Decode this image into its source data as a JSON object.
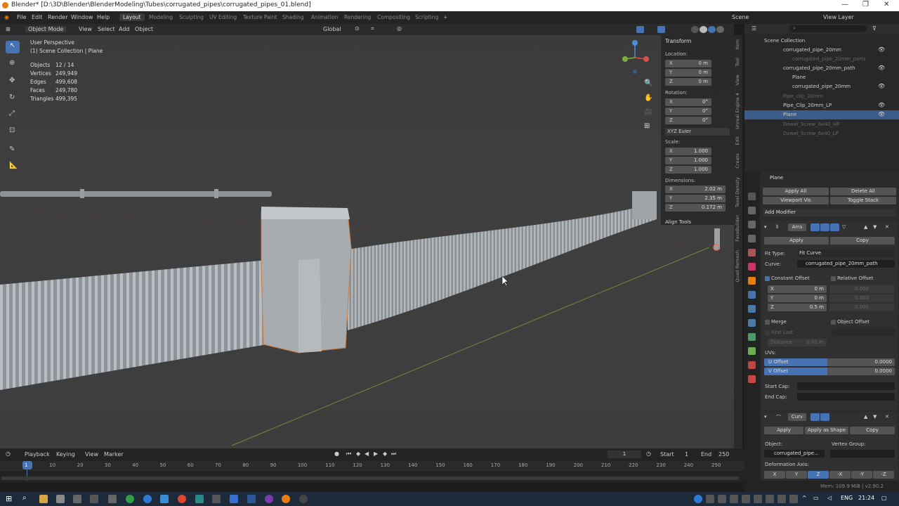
{
  "titlebar": {
    "title": "Blender* [D:\\3D\\Blender\\BlenderModeling\\Tubes\\corrugated_pipes\\corrugated_pipes_01.blend]",
    "minimize": "—",
    "maximize": "❐",
    "close": "✕"
  },
  "menu": [
    "File",
    "Edit",
    "Render",
    "Window",
    "Help"
  ],
  "workspaces": [
    "Layout",
    "Modeling",
    "Sculpting",
    "UV Editing",
    "Texture Paint",
    "Shading",
    "Animation",
    "Rendering",
    "Compositing",
    "Scripting"
  ],
  "scene": {
    "label": "Scene",
    "view_layer": "View Layer"
  },
  "vp_header": {
    "mode": "Object Mode",
    "menus": [
      "View",
      "Select",
      "Add",
      "Object"
    ],
    "transform": "Global"
  },
  "viewport": {
    "perspective": "User Perspective",
    "collection": "(1) Scene Collection | Plane",
    "stats": [
      {
        "k": "Objects",
        "v": "12 / 14"
      },
      {
        "k": "Vertices",
        "v": "249,949"
      },
      {
        "k": "Edges",
        "v": "499,608"
      },
      {
        "k": "Faces",
        "v": "249,780"
      },
      {
        "k": "Triangles",
        "v": "499,395"
      }
    ]
  },
  "npanel": {
    "transform_title": "Transform",
    "location_label": "Location:",
    "location": [
      {
        "k": "X",
        "v": "0 m"
      },
      {
        "k": "Y",
        "v": "0 m"
      },
      {
        "k": "Z",
        "v": "0 m"
      }
    ],
    "rotation_label": "Rotation:",
    "rotation": [
      {
        "k": "X",
        "v": "0°"
      },
      {
        "k": "Y",
        "v": "0°"
      },
      {
        "k": "Z",
        "v": "0°"
      }
    ],
    "rotation_mode": "XYZ Euler",
    "scale_label": "Scale:",
    "scale": [
      {
        "k": "X",
        "v": "1.000"
      },
      {
        "k": "Y",
        "v": "1.000"
      },
      {
        "k": "Z",
        "v": "1.000"
      }
    ],
    "dimensions_label": "Dimensions:",
    "dimensions": [
      {
        "k": "X",
        "v": "2.02 m"
      },
      {
        "k": "Y",
        "v": "2.35 m"
      },
      {
        "k": "Z",
        "v": "0.172 m"
      }
    ],
    "align_tools": "Align Tools"
  },
  "vtabs": [
    "Item",
    "Tool",
    "View",
    "Unreal Engine 4",
    "Edit",
    "Create",
    "Texel Density",
    "FaceBuilder",
    "Quad Remesh"
  ],
  "outliner": {
    "search_placeholder": "",
    "rows": [
      {
        "label": "Scene Collection",
        "indent": 0,
        "dim": false,
        "sel": false
      },
      {
        "label": "corrugated_pipe_20mm",
        "indent": 1,
        "dim": false,
        "sel": false
      },
      {
        "label": "corrugated_pipe_20mm_parts",
        "indent": 2,
        "dim": true,
        "sel": false
      },
      {
        "label": "corrugated_pipe_20mm_path",
        "indent": 2,
        "dim": false,
        "sel": false
      },
      {
        "label": "Plane",
        "indent": 3,
        "dim": false,
        "sel": false
      },
      {
        "label": "corrugated_pipe_20mm",
        "indent": 3,
        "dim": false,
        "sel": false
      },
      {
        "label": "Pipe_clip_20mm",
        "indent": 1,
        "dim": true,
        "sel": false
      },
      {
        "label": "Pipe_Clip_20mm_LP",
        "indent": 1,
        "dim": false,
        "sel": false
      },
      {
        "label": "Plane",
        "indent": 2,
        "dim": false,
        "sel": true
      },
      {
        "label": "Dowel_Screw_6x40_HP",
        "indent": 1,
        "dim": true,
        "sel": false
      },
      {
        "label": "Dowel_Screw_6x40_LP",
        "indent": 1,
        "dim": true,
        "sel": false
      }
    ]
  },
  "props": {
    "object": "Plane",
    "apply_all": "Apply All",
    "delete_all": "Delete All",
    "viewport_vis": "Viewport Vis",
    "toggle_stack": "Toggle Stack",
    "add_modifier": "Add Modifier",
    "array": {
      "name": "Arra",
      "apply": "Apply",
      "copy": "Copy",
      "fit_type_label": "Fit Type:",
      "fit_type": "Fit Curve",
      "curve_label": "Curve:",
      "curve": "corrugated_pipe_20mm_path",
      "constant_offset": "Constant Offset",
      "relative_offset": "Relative Offset",
      "const": [
        {
          "k": "X",
          "v": "0 m"
        },
        {
          "k": "Y",
          "v": "0 m"
        },
        {
          "k": "Z",
          "v": "0.5 m"
        }
      ],
      "rel": [
        {
          "k": "",
          "v": "0.000"
        },
        {
          "k": "",
          "v": "0.000"
        },
        {
          "k": "",
          "v": "0.000"
        }
      ],
      "merge": "Merge",
      "object_offset": "Object Offset",
      "first_last": "First Last",
      "distance": "Distance",
      "distance_val": "0.01 m",
      "uvs": "UVs:",
      "u_offset": "U Offset",
      "u_val": "0.0000",
      "v_offset": "V Offset",
      "v_val": "0.0000",
      "start_cap": "Start Cap:",
      "end_cap": "End Cap:"
    },
    "curve_mod": {
      "name": "Curv",
      "apply": "Apply",
      "apply_shape": "Apply as Shape",
      "copy": "Copy",
      "object_label": "Object:",
      "object": "corrugated_pipe...",
      "vertex_group": "Vertex Group:",
      "deform_axis": "Deformation Axis:",
      "axes": [
        "X",
        "Y",
        "Z",
        "-X",
        "-Y",
        "-Z"
      ]
    }
  },
  "timeline": {
    "menus": [
      "Playback",
      "Keying",
      "View",
      "Marker"
    ],
    "current": "1",
    "start_label": "Start",
    "start": "1",
    "end_label": "End",
    "end": "250",
    "ticks": [
      "1",
      "10",
      "20",
      "30",
      "40",
      "50",
      "60",
      "70",
      "80",
      "90",
      "100",
      "110",
      "120",
      "130",
      "140",
      "150",
      "160",
      "170",
      "180",
      "190",
      "200",
      "210",
      "220",
      "230",
      "240",
      "250"
    ]
  },
  "status": {
    "mem": "Mem: 109.9 MiB | v2.90.2"
  },
  "taskbar": {
    "lang": "ENG",
    "time": "21:24"
  },
  "colors": {
    "accent": "#4772b3",
    "selection": "#3b5b8a",
    "orange": "#e87d0d"
  }
}
